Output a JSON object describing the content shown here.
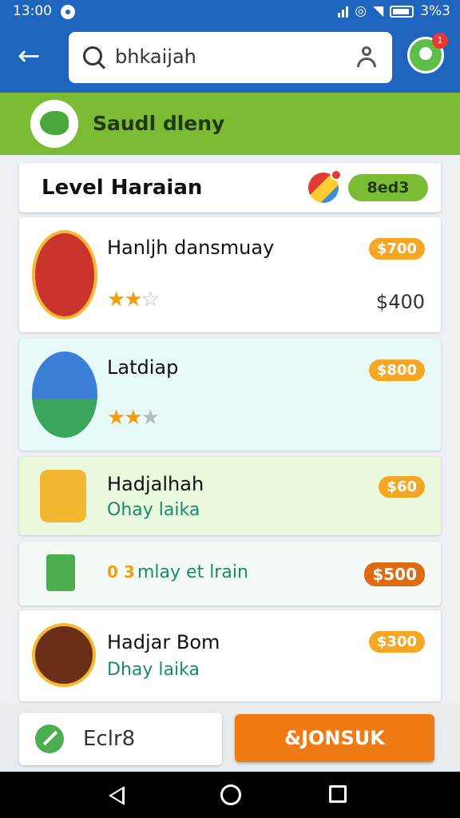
{
  "status": {
    "time": "13:00",
    "battery": "3%3"
  },
  "header": {
    "search_value": "bhkaijah"
  },
  "banner": {
    "title": "Saudl dleny"
  },
  "level": {
    "title": "Level Haraian",
    "badge": "8ed3"
  },
  "items": [
    {
      "name": "Hanljh dansmuay",
      "price": "$700",
      "price2": "$400",
      "rating": 2.5
    },
    {
      "name": "Latdiap",
      "price": "$800",
      "rating": 2
    },
    {
      "name": "Hadjalhah",
      "subtitle": "Ohay laika",
      "price": "$60"
    },
    {
      "name": "mlay et lrain",
      "prefix": "0 3",
      "price": "$500"
    },
    {
      "name": "Hadjar Bom",
      "subtitle": "Dhay laika",
      "price": "$300"
    }
  ],
  "footer": {
    "left_label": "Eclr8",
    "cta_label": "&JONSUK"
  },
  "colors": {
    "primary_blue": "#1f64bd",
    "green": "#7cbc35",
    "orange": "#f07b14",
    "price_badge": "#f5a623"
  }
}
